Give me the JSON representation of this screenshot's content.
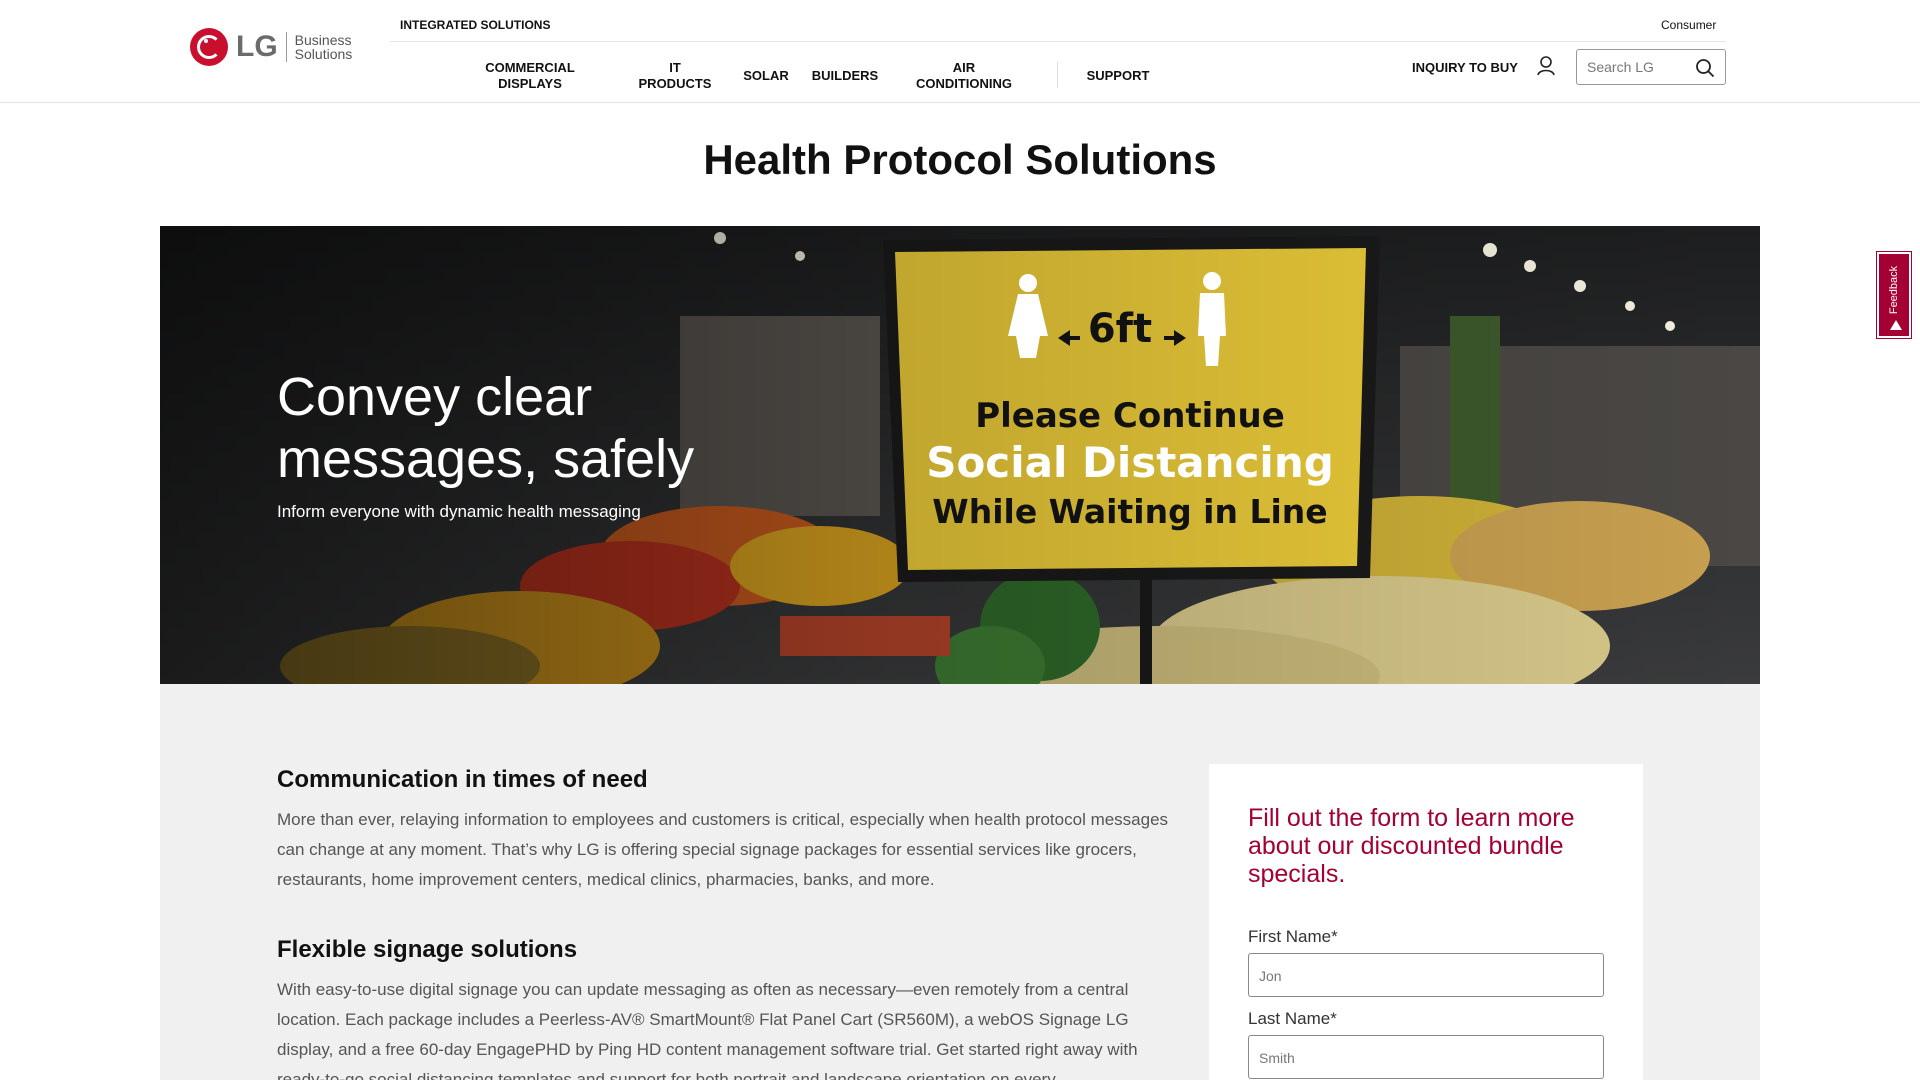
{
  "header": {
    "logo": {
      "brand": "LG",
      "sub_line1": "Business",
      "sub_line2": "Solutions"
    },
    "top_left_label": "INTEGRATED SOLUTIONS",
    "top_right_label": "Consumer",
    "nav": [
      {
        "line1": "COMMERCIAL",
        "line2": "DISPLAYS"
      },
      {
        "line1": "IT",
        "line2": "PRODUCTS"
      },
      {
        "line1": "SOLAR",
        "line2": ""
      },
      {
        "line1": "BUILDERS",
        "line2": ""
      },
      {
        "line1": "AIR",
        "line2": "CONDITIONING"
      },
      {
        "line1": "SUPPORT",
        "line2": ""
      }
    ],
    "inquiry_label": "INQUIRY TO BUY",
    "search": {
      "placeholder": "Search LG",
      "value": ""
    }
  },
  "page_title": "Health Protocol Solutions",
  "hero": {
    "heading": "Convey clear messages, safely",
    "subheading": "Inform everyone with dynamic health messaging",
    "sign": {
      "distance": "6ft",
      "line1": "Please Continue",
      "line2": "Social Distancing",
      "line3": "While Waiting in Line"
    }
  },
  "sections": [
    {
      "heading": "Communication in times of need",
      "body": "More than ever, relaying information to employees and customers is critical, especially when health protocol messages can change at any moment. That’s why LG is offering special signage packages for essential services like grocers, restaurants, home improvement centers, medical clinics, pharmacies, banks, and more."
    },
    {
      "heading": "Flexible signage solutions",
      "body": "With easy-to-use digital signage you can update messaging as often as necessary—even remotely from a central location. Each package includes a Peerless-AV® SmartMount® Flat Panel Cart (SR560M), a webOS Signage LG display, and a free 60-day EngagePHD by Ping HD content management software trial. Get started right away with ready-to-go social distancing templates and support for both portrait and landscape orientation on every"
    }
  ],
  "form": {
    "title": "Fill out the form to learn more about our discounted bundle specials.",
    "first_name": {
      "label": "First Name*",
      "placeholder": "Jon",
      "value": ""
    },
    "last_name": {
      "label": "Last Name*",
      "placeholder": "Smith",
      "value": ""
    }
  },
  "feedback_tab": {
    "label": "Feedback"
  },
  "colors": {
    "brand": "#a50034",
    "logo_red": "#c8102e",
    "band": "#f0f0f0",
    "sign_yellow": "#f0cf3a"
  },
  "icons": [
    "lg-logo-icon",
    "user-icon",
    "search-icon",
    "feedback-arrow-icon",
    "person-female-icon",
    "person-male-icon",
    "double-arrow-icon"
  ]
}
